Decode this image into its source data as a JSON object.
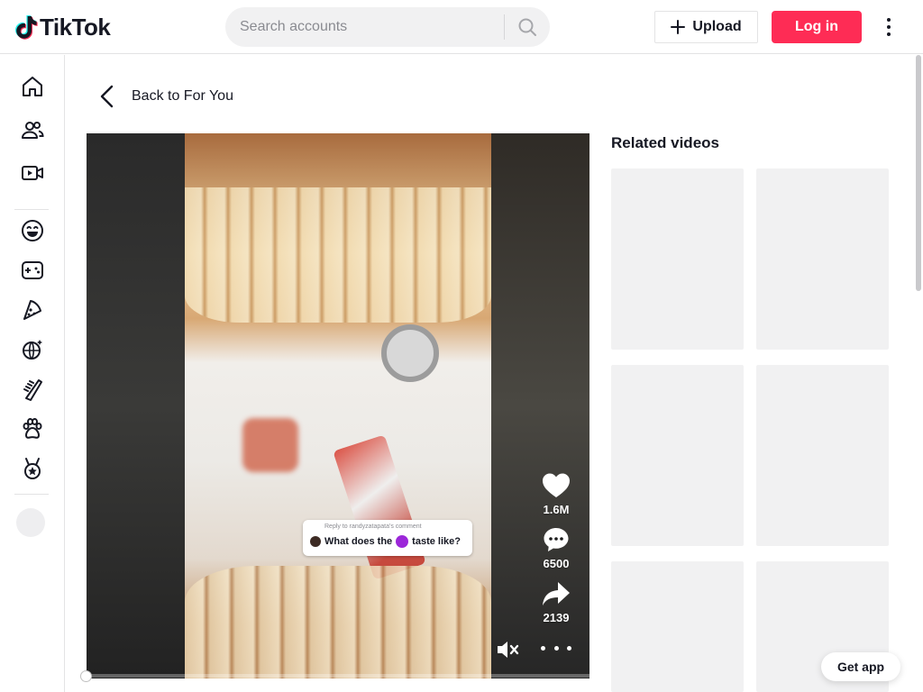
{
  "header": {
    "logo_text": "TikTok",
    "search_placeholder": "Search accounts",
    "upload_label": "Upload",
    "login_label": "Log in"
  },
  "sidebar": {
    "items": [
      {
        "icon": "home-icon"
      },
      {
        "icon": "following-icon"
      },
      {
        "icon": "live-icon"
      },
      {
        "icon": "comedy-icon"
      },
      {
        "icon": "gaming-icon"
      },
      {
        "icon": "food-icon"
      },
      {
        "icon": "dance-icon"
      },
      {
        "icon": "beauty-icon"
      },
      {
        "icon": "animals-icon"
      },
      {
        "icon": "sports-icon"
      }
    ]
  },
  "back_link": {
    "label": "Back to For You"
  },
  "video": {
    "reply": {
      "meta": "Reply to randyzatapata's comment",
      "question_before": "What does the",
      "question_after": "taste like?"
    },
    "likes": "1.6M",
    "comments": "6500",
    "shares": "2139",
    "progress": 0.0
  },
  "related": {
    "title": "Related videos",
    "thumbnails": 6
  },
  "get_app_label": "Get app",
  "colors": {
    "accent": "#fe2c55",
    "text": "#161823",
    "placeholder_bg": "#f1f1f2"
  }
}
